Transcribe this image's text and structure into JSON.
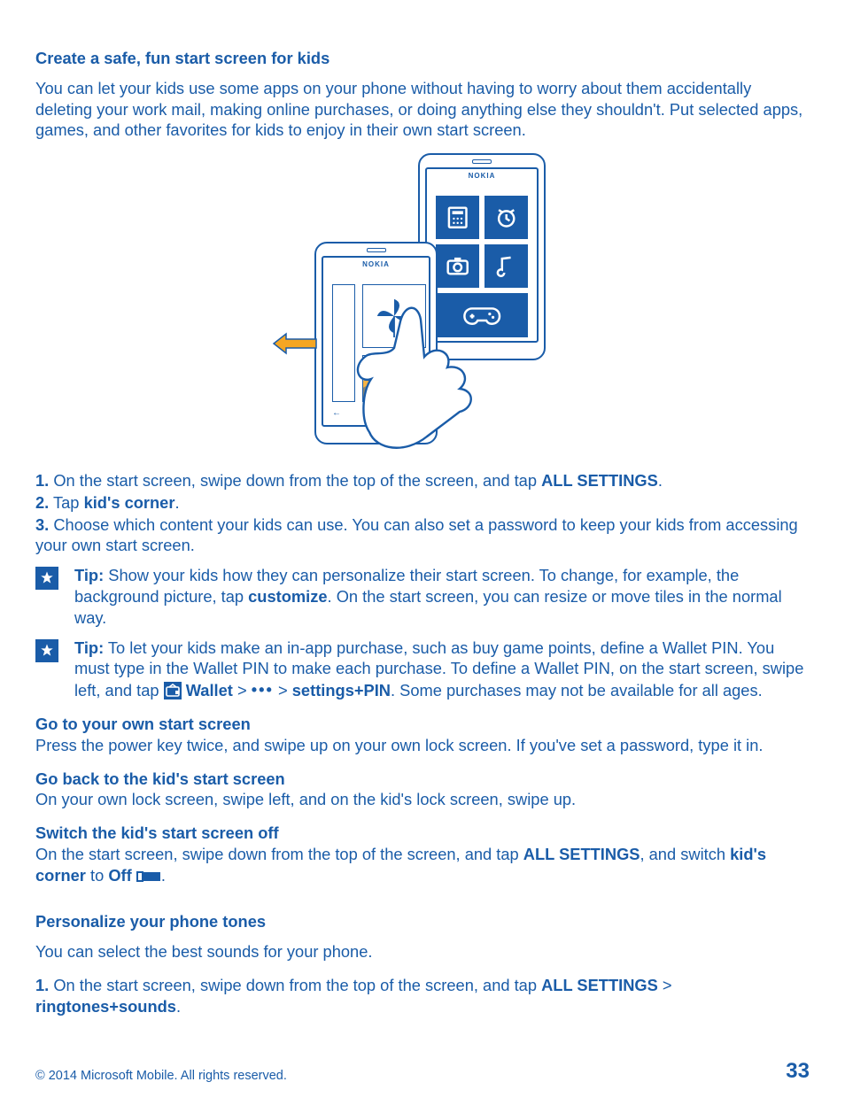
{
  "s1": {
    "heading": "Create a safe, fun start screen for kids",
    "intro": "You can let your kids use some apps on your phone without having to worry about them accidentally deleting your work mail, making online purchases, or doing anything else they shouldn't. Put selected apps, games, and other favorites for kids to enjoy in their own start screen.",
    "nokia": "NOKIA",
    "step1_num": "1.",
    "step1_a": " On the start screen, swipe down from the top of the screen, and tap ",
    "step1_b": "ALL SETTINGS",
    "step1_c": ".",
    "step2_num": "2.",
    "step2_a": " Tap ",
    "step2_b": "kid's corner",
    "step2_c": ".",
    "step3_num": "3.",
    "step3_a": " Choose which content your kids can use. You can also set a password to keep your kids from accessing your own start screen.",
    "tip1_label": "Tip:",
    "tip1_a": " Show your kids how they can personalize their start screen. To change, for example, the background picture, tap ",
    "tip1_b": "customize",
    "tip1_c": ". On the start screen, you can resize or move tiles in the normal way.",
    "tip2_label": "Tip:",
    "tip2_a": " To let your kids make an in-app purchase, such as buy game points, define a Wallet PIN. You must type in the Wallet PIN to make each purchase. To define a Wallet PIN, on the start screen, swipe left, and tap ",
    "tip2_wallet": " Wallet",
    "tip2_gt1": " > ",
    "tip2_gt2": " > ",
    "tip2_settings": "settings+PIN",
    "tip2_end": ". Some purchases may not be available for all ages.",
    "sub_goto": "Go to your own start screen",
    "goto_text": "Press the power key twice, and swipe up on your own lock screen. If you've set a password, type it in.",
    "sub_goback": "Go back to the kid's start screen",
    "goback_text": "On your own lock screen, swipe left, and on the kid's lock screen, swipe up.",
    "sub_switch": "Switch the kid's start screen off",
    "switch_a": "On the start screen, swipe down from the top of the screen, and tap ",
    "switch_b": "ALL SETTINGS",
    "switch_c": ", and switch ",
    "switch_d": "kid's corner",
    "switch_e": " to ",
    "switch_f": "Off",
    "switch_g": " ",
    "switch_h": "."
  },
  "s2": {
    "heading": "Personalize your phone tones",
    "intro": "You can select the best sounds for your phone.",
    "step1_num": "1.",
    "step1_a": " On the start screen, swipe down from the top of the screen, and tap ",
    "step1_b": "ALL SETTINGS",
    "step1_c": " > ",
    "step1_d": "ringtones+sounds",
    "step1_e": "."
  },
  "footer": {
    "copyright": "© 2014 Microsoft Mobile. All rights reserved.",
    "page": "33"
  },
  "dots": "•••"
}
